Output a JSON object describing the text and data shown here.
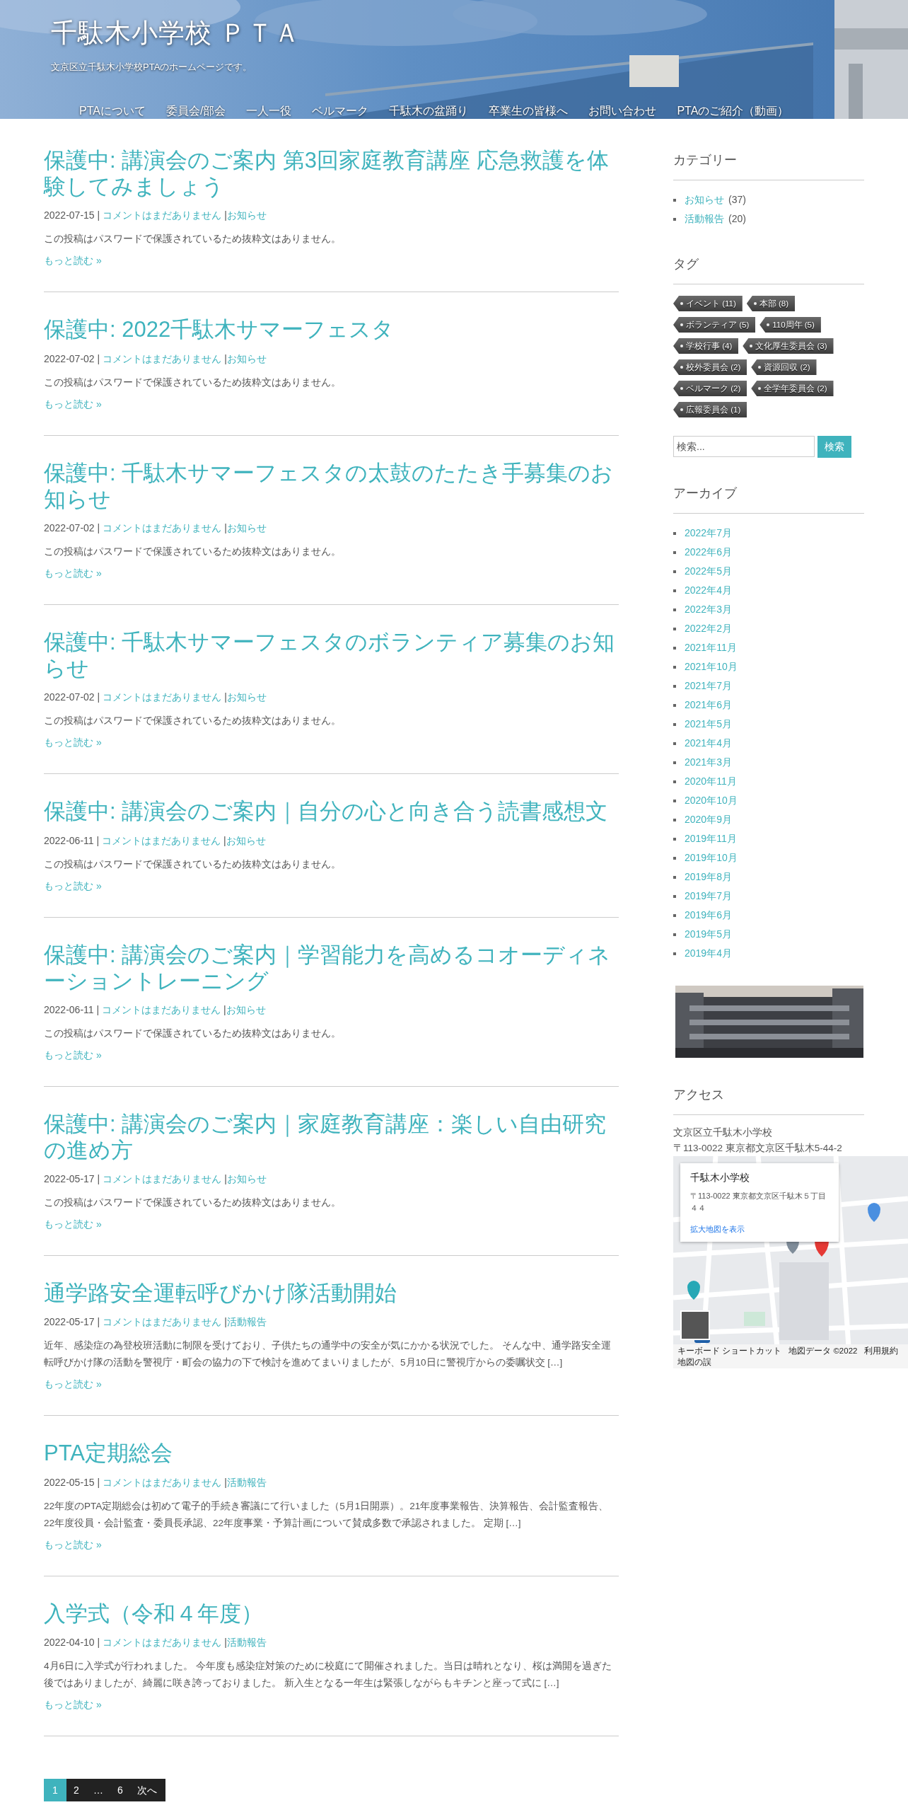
{
  "header": {
    "title": "千駄木小学校 ＰＴＡ",
    "tagline": "文京区立千駄木小学校PTAのホームページです。",
    "nav": [
      "PTAについて",
      "委員会/部会",
      "一人一役",
      "ベルマーク",
      "千駄木の盆踊り",
      "卒業生の皆様へ",
      "お問い合わせ",
      "PTAのご紹介（動画）"
    ]
  },
  "posts": [
    {
      "title": "保護中: 講演会のご案内 第3回家庭教育講座 応急救護を体験してみましょう",
      "date": "2022-07-15 |",
      "comments": "コメントはまだありません",
      "sep": "|",
      "category": "お知らせ",
      "excerpt": "この投稿はパスワードで保護されているため抜粋文はありません。",
      "more": "もっと読む »"
    },
    {
      "title": "保護中: 2022千駄木サマーフェスタ",
      "date": "2022-07-02 |",
      "comments": "コメントはまだありません",
      "sep": "|",
      "category": "お知らせ",
      "excerpt": "この投稿はパスワードで保護されているため抜粋文はありません。",
      "more": "もっと読む »"
    },
    {
      "title": "保護中: 千駄木サマーフェスタの太鼓のたたき手募集のお知らせ",
      "date": "2022-07-02 |",
      "comments": "コメントはまだありません",
      "sep": "|",
      "category": "お知らせ",
      "excerpt": "この投稿はパスワードで保護されているため抜粋文はありません。",
      "more": "もっと読む »"
    },
    {
      "title": "保護中: 千駄木サマーフェスタのボランティア募集のお知らせ",
      "date": "2022-07-02 |",
      "comments": "コメントはまだありません",
      "sep": "|",
      "category": "お知らせ",
      "excerpt": "この投稿はパスワードで保護されているため抜粋文はありません。",
      "more": "もっと読む »"
    },
    {
      "title": "保護中: 講演会のご案内｜自分の心と向き合う読書感想文",
      "date": "2022-06-11 |",
      "comments": "コメントはまだありません",
      "sep": "|",
      "category": "お知らせ",
      "excerpt": "この投稿はパスワードで保護されているため抜粋文はありません。",
      "more": "もっと読む »"
    },
    {
      "title": "保護中: 講演会のご案内｜学習能力を高めるコオーディネーショントレーニング",
      "date": "2022-06-11 |",
      "comments": "コメントはまだありません",
      "sep": "|",
      "category": "お知らせ",
      "excerpt": "この投稿はパスワードで保護されているため抜粋文はありません。",
      "more": "もっと読む »"
    },
    {
      "title": "保護中: 講演会のご案内｜家庭教育講座：楽しい自由研究の進め方",
      "date": "2022-05-17 |",
      "comments": "コメントはまだありません",
      "sep": "|",
      "category": "お知らせ",
      "excerpt": "この投稿はパスワードで保護されているため抜粋文はありません。",
      "more": "もっと読む »"
    },
    {
      "title": "通学路安全運転呼びかけ隊活動開始",
      "date": "2022-05-17 |",
      "comments": "コメントはまだありません",
      "sep": "|",
      "category": "活動報告",
      "excerpt": "近年、感染症の為登校班活動に制限を受けており、子供たちの通学中の安全が気にかかる状況でした。 そんな中、通学路安全運転呼びかけ隊の活動を警視庁・町会の協力の下で検討を進めてまいりましたが、5月10日に警視庁からの委嘱状交 […]",
      "more": "もっと読む »"
    },
    {
      "title": "PTA定期総会",
      "date": "2022-05-15 |",
      "comments": "コメントはまだありません",
      "sep": "|",
      "category": "活動報告",
      "excerpt": "22年度のPTA定期総会は初めて電子的手続き審議にて行いました（5月1日開票）。21年度事業報告、決算報告、会計監査報告、22年度役員・会計監査・委員長承認、22年度事業・予算計画について賛成多数で承認されました。 定期 […]",
      "more": "もっと読む »"
    },
    {
      "title": "入学式（令和４年度）",
      "date": "2022-04-10 |",
      "comments": "コメントはまだありません",
      "sep": "|",
      "category": "活動報告",
      "excerpt": "4月6日に入学式が行われました。 今年度も感染症対策のために校庭にて開催されました。当日は晴れとなり、桜は満開を過ぎた後ではありましたが、綺麗に咲き誇っておりました。 新入生となる一年生は緊張しながらもキチンと座って式に […]",
      "more": "もっと読む »"
    }
  ],
  "pagination": [
    {
      "label": "1",
      "selected": true
    },
    {
      "label": "2",
      "selected": false
    },
    {
      "label": "…",
      "selected": false
    },
    {
      "label": "6",
      "selected": false
    },
    {
      "label": "次へ",
      "selected": false
    }
  ],
  "sidebar": {
    "categories": {
      "heading": "カテゴリー",
      "items": [
        {
          "label": "お知らせ",
          "count": "(37)"
        },
        {
          "label": "活動報告",
          "count": "(20)"
        }
      ]
    },
    "tags": {
      "heading": "タグ",
      "items": [
        "イベント (11)",
        "本部 (8)",
        "ボランティア (5)",
        "110周年 (5)",
        "学校行事 (4)",
        "文化厚生委員会 (3)",
        "校外委員会 (2)",
        "資源回収 (2)",
        "ベルマーク (2)",
        "全学年委員会 (2)",
        "広報委員会 (1)"
      ]
    },
    "search": {
      "placeholder": "検索...",
      "button": "検索"
    },
    "archives": {
      "heading": "アーカイブ",
      "items": [
        "2022年7月",
        "2022年6月",
        "2022年5月",
        "2022年4月",
        "2022年3月",
        "2022年2月",
        "2021年11月",
        "2021年10月",
        "2021年7月",
        "2021年6月",
        "2021年5月",
        "2021年4月",
        "2021年3月",
        "2020年11月",
        "2020年10月",
        "2020年9月",
        "2019年11月",
        "2019年10月",
        "2019年8月",
        "2019年7月",
        "2019年6月",
        "2019年5月",
        "2019年4月"
      ]
    },
    "access": {
      "heading": "アクセス",
      "lines": [
        "文京区立千駄木小学校",
        "〒113-0022 東京都文京区千駄木5-44-2"
      ],
      "map": {
        "place": "千駄木小学校",
        "address": "〒113-0022 東京都文京区千駄木５丁目４４",
        "link": "拡大地図を表示",
        "footer": [
          "キーボード ショートカット",
          "地図データ ©2022",
          "利用規約",
          "地図の誤"
        ]
      }
    }
  }
}
